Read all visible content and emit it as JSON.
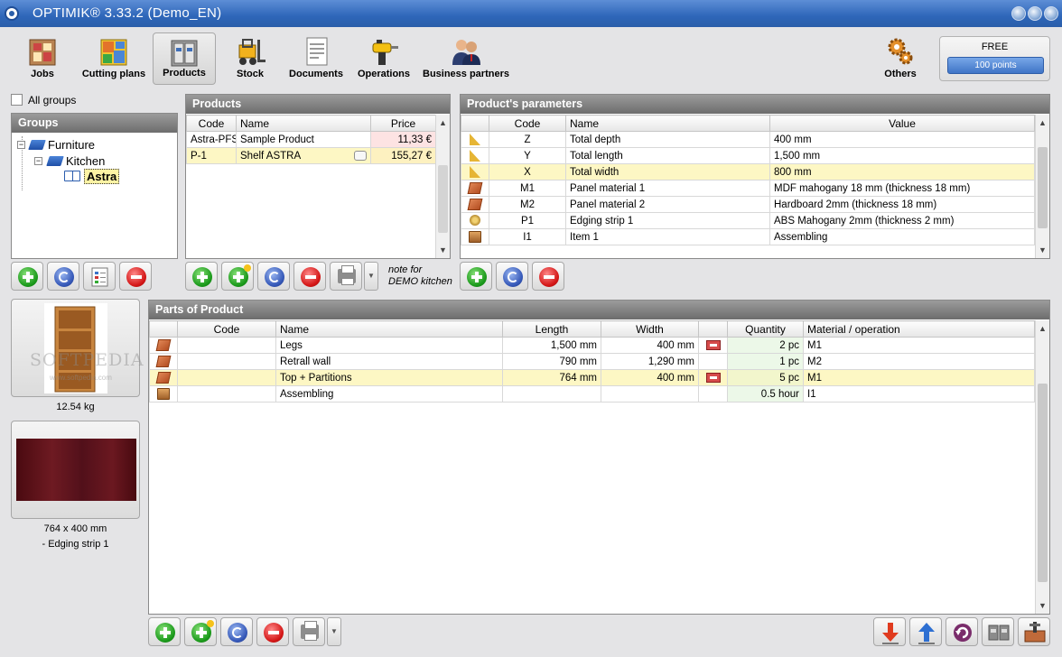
{
  "window": {
    "title": "OPTIMIK® 3.33.2  (Demo_EN)"
  },
  "toolbar": {
    "jobs": "Jobs",
    "cutting_plans": "Cutting plans",
    "products": "Products",
    "stock": "Stock",
    "documents": "Documents",
    "operations": "Operations",
    "business_partners": "Business partners",
    "others": "Others"
  },
  "license": {
    "label": "FREE",
    "points": "100 points"
  },
  "groups": {
    "all_groups_label": "All groups",
    "title": "Groups",
    "tree": [
      {
        "label": "Furniture"
      },
      {
        "label": "Kitchen"
      },
      {
        "label": "Astra"
      }
    ]
  },
  "products": {
    "title": "Products",
    "columns": [
      "Code",
      "Name",
      "Price"
    ],
    "rows": [
      {
        "code": "Astra-PFS",
        "name": "Sample Product",
        "price": "11,33 €"
      },
      {
        "code": "P-1",
        "name": "Shelf ASTRA",
        "price": "155,27 €"
      }
    ],
    "note": "note for\nDEMO kitchen"
  },
  "parameters": {
    "title": "Product's parameters",
    "columns": [
      "Code",
      "Name",
      "Value"
    ],
    "rows": [
      {
        "icon": "ruler-icon",
        "code": "Z",
        "name": "Total depth",
        "value": "400 mm"
      },
      {
        "icon": "ruler-icon",
        "code": "Y",
        "name": "Total length",
        "value": "1,500 mm"
      },
      {
        "icon": "ruler-icon",
        "code": "X",
        "name": "Total width",
        "value": "800 mm"
      },
      {
        "icon": "panel-material-icon",
        "code": "M1",
        "name": "Panel material 1",
        "value": "MDF mahogany 18 mm  (thickness 18 mm)"
      },
      {
        "icon": "panel-material-icon",
        "code": "M2",
        "name": "Panel material 2",
        "value": "Hardboard 2mm  (thickness 18 mm)"
      },
      {
        "icon": "edging-strip-icon",
        "code": "P1",
        "name": "Edging strip 1",
        "value": "ABS Mahogany 2mm  (thickness 2 mm)"
      },
      {
        "icon": "item-icon",
        "code": "I1",
        "name": "Item 1",
        "value": "Assembling"
      }
    ]
  },
  "parts": {
    "title": "Parts of Product",
    "columns": [
      "Code",
      "Name",
      "Length",
      "Width",
      "Quantity",
      "Material / operation"
    ],
    "rows": [
      {
        "code": "",
        "name": "Legs",
        "length": "1,500 mm",
        "width": "400 mm",
        "quantity": "2 pc",
        "material": "M1"
      },
      {
        "code": "",
        "name": "Retrall wall",
        "length": "790 mm",
        "width": "1,290 mm",
        "quantity": "1 pc",
        "material": "M2"
      },
      {
        "code": "",
        "name": "Top + Partitions",
        "length": "764 mm",
        "width": "400 mm",
        "quantity": "5 pc",
        "material": "M1"
      },
      {
        "code": "",
        "name": "Assembling",
        "length": "",
        "width": "",
        "quantity": "0.5 hour",
        "material": "I1"
      }
    ]
  },
  "preview": {
    "weight": "12.54 kg",
    "dimensions": "764 x 400 mm",
    "edging": "-  Edging strip 1",
    "watermark": "SOFTPEDIA",
    "watermark_url": "www.softpedia.com"
  },
  "colors": {
    "selection": "#fdf7c4",
    "title_bar": "#2e66b9",
    "header": "#7a7a7a"
  }
}
